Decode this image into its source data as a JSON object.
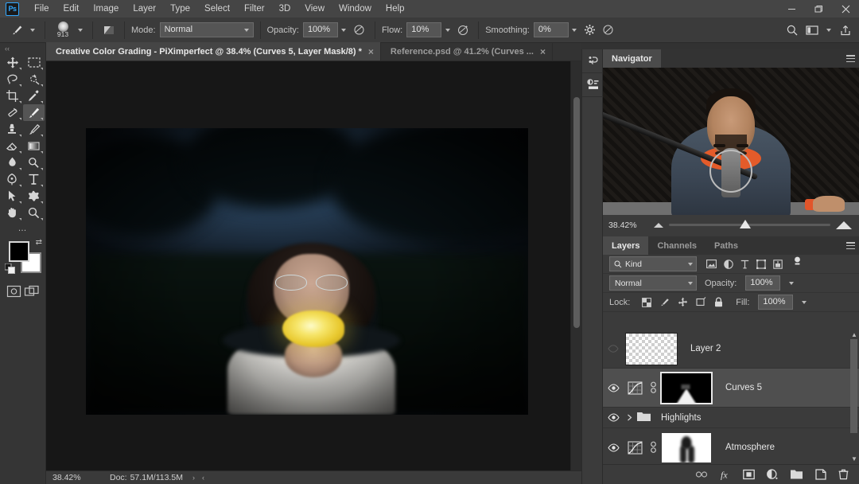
{
  "app": {
    "logo": "Ps",
    "menus": [
      "File",
      "Edit",
      "Image",
      "Layer",
      "Type",
      "Select",
      "Filter",
      "3D",
      "View",
      "Window",
      "Help"
    ],
    "window_controls": {
      "minimize": "minimize-icon",
      "restore": "restore-icon",
      "close": "close-icon"
    }
  },
  "options_bar": {
    "tool_icon": "brush-tool-icon",
    "tool_preset_caret": "chevron-down-icon",
    "brush_size": "913",
    "brush_panel_caret": "chevron-down-icon",
    "brush_settings_icon": "brush-settings-icon",
    "mode_label": "Mode:",
    "mode_value": "Normal",
    "opacity_label": "Opacity:",
    "opacity_value": "100%",
    "pressure_opacity_icon": "pressure-opacity-icon",
    "flow_label": "Flow:",
    "flow_value": "10%",
    "airbrush_icon": "airbrush-icon",
    "smoothing_label": "Smoothing:",
    "smoothing_value": "0%",
    "smoothing_options_icon": "gear-icon",
    "tablet_pressure_icon": "tablet-pressure-icon",
    "right_icons": [
      "search-icon",
      "workspace-icon",
      "chevron-down-icon",
      "share-icon"
    ]
  },
  "toolbar": {
    "collapse_icon": "collapse-chevrons-icon",
    "tools": [
      {
        "name": "move-tool",
        "icon": "move-icon",
        "active": false,
        "has_flyout": true
      },
      {
        "name": "rectangular-marquee-tool",
        "icon": "marquee-icon",
        "active": false,
        "has_flyout": true
      },
      {
        "name": "lasso-tool",
        "icon": "lasso-icon",
        "active": false,
        "has_flyout": true
      },
      {
        "name": "quick-selection-tool",
        "icon": "quick-select-icon",
        "active": false,
        "has_flyout": true
      },
      {
        "name": "crop-tool",
        "icon": "crop-icon",
        "active": false,
        "has_flyout": true
      },
      {
        "name": "eyedropper-tool",
        "icon": "eyedropper-icon",
        "active": false,
        "has_flyout": true
      },
      {
        "name": "spot-healing-brush-tool",
        "icon": "healing-brush-icon",
        "active": false,
        "has_flyout": true
      },
      {
        "name": "brush-tool",
        "icon": "brush-icon",
        "active": true,
        "has_flyout": true
      },
      {
        "name": "clone-stamp-tool",
        "icon": "clone-stamp-icon",
        "active": false,
        "has_flyout": true
      },
      {
        "name": "history-brush-tool",
        "icon": "history-brush-icon",
        "active": false,
        "has_flyout": true
      },
      {
        "name": "eraser-tool",
        "icon": "eraser-icon",
        "active": false,
        "has_flyout": true
      },
      {
        "name": "gradient-tool",
        "icon": "gradient-icon",
        "active": false,
        "has_flyout": true
      },
      {
        "name": "blur-tool",
        "icon": "blur-drop-icon",
        "active": false,
        "has_flyout": true
      },
      {
        "name": "dodge-tool",
        "icon": "dodge-icon",
        "active": false,
        "has_flyout": true
      },
      {
        "name": "pen-tool",
        "icon": "pen-icon",
        "active": false,
        "has_flyout": true
      },
      {
        "name": "type-tool",
        "icon": "type-t-icon",
        "active": false,
        "has_flyout": true
      },
      {
        "name": "path-selection-tool",
        "icon": "path-arrow-icon",
        "active": false,
        "has_flyout": true
      },
      {
        "name": "custom-shape-tool",
        "icon": "shape-icon",
        "active": false,
        "has_flyout": true
      },
      {
        "name": "hand-tool",
        "icon": "hand-icon",
        "active": false,
        "has_flyout": true
      },
      {
        "name": "zoom-tool",
        "icon": "magnifier-icon",
        "active": false,
        "has_flyout": true
      }
    ],
    "more_tools": "…",
    "foreground_color": "#000000",
    "background_color": "#ffffff",
    "swap_icon": "swap-colors-icon",
    "default_icon": "default-colors-icon",
    "quick_mask_icon": "quick-mask-icon",
    "screen_mode_icon": "screen-mode-icon"
  },
  "document_tabs": [
    {
      "title": "Creative Color Grading - PiXimperfect @ 38.4% (Curves 5, Layer Mask/8) *",
      "active": true,
      "close": "×"
    },
    {
      "title": "Reference.psd @ 41.2% (Curves ...",
      "active": false,
      "close": "×"
    }
  ],
  "canvas": {
    "image_alt": "portrait-of-woman-holding-glowing-yellow-rose-at-twilight",
    "scrollbar_v": "canvas-vertical-scrollbar",
    "scrollbar_h": "canvas-horizontal-scrollbar"
  },
  "status_bar": {
    "zoom": "38.42%",
    "doc_label": "Doc:",
    "doc_value": "57.1M/113.5M",
    "next_arrow": "›",
    "prev_arrow": "‹"
  },
  "dock_rail": [
    {
      "name": "history-panel-icon",
      "label": "History"
    },
    {
      "name": "adjustments-panel-icon",
      "label": "Adjustments"
    }
  ],
  "navigator": {
    "tab": "Navigator",
    "menu_icon": "panel-menu-icon",
    "zoom_value": "38.42%",
    "zoom_out_icon": "small-mountain-icon",
    "zoom_in_icon": "large-mountain-icon",
    "slider_position_pct": 44
  },
  "video_overlay": {
    "name": "presenter-webcam-overlay",
    "description": "presenter seated at microphone in acoustic-foam studio"
  },
  "layers_panel": {
    "tabs": [
      {
        "label": "Layers",
        "active": true
      },
      {
        "label": "Channels",
        "active": false
      },
      {
        "label": "Paths",
        "active": false
      }
    ],
    "menu_icon": "panel-menu-icon",
    "filter": {
      "search_icon": "search-icon",
      "kind_value": "Kind",
      "caret": "chevron-down-icon",
      "type_filters": [
        "filter-pixel-layers-icon",
        "filter-adjustment-layers-icon",
        "filter-type-layers-icon",
        "filter-shape-layers-icon",
        "filter-smart-objects-icon"
      ],
      "toggle_icon": "filter-toggle-switch-icon"
    },
    "blend_mode": "Normal",
    "opacity_label": "Opacity:",
    "opacity_value": "100%",
    "lock_label": "Lock:",
    "lock_icons": [
      "lock-transparent-pixels-icon",
      "lock-image-pixels-icon",
      "lock-position-icon",
      "lock-artboard-nesting-icon",
      "lock-all-icon"
    ],
    "fill_label": "Fill:",
    "fill_value": "100%",
    "layers": [
      {
        "name": "Layer 2",
        "type": "pixel",
        "visible": false,
        "selected": false,
        "thumb": "transparent-checkerboard-thumbnail",
        "has_mask": false
      },
      {
        "name": "Curves 5",
        "type": "adjustment",
        "visible": true,
        "selected": true,
        "thumb": "curves-adjustment-icon",
        "has_mask": true,
        "mask": "black-mask-with-white-brush-strokes",
        "link_icon": "link-icon"
      },
      {
        "name": "Highlights",
        "type": "group",
        "visible": true,
        "selected": false,
        "expand_icon": "chevron-right-icon",
        "folder_icon": "folder-icon"
      },
      {
        "name": "Atmosphere",
        "type": "adjustment",
        "visible": true,
        "selected": false,
        "thumb": "curves-adjustment-icon",
        "has_mask": true,
        "mask": "white-mask-with-black-painted-figure",
        "link_icon": "link-icon"
      }
    ],
    "footer_icons": [
      "link-layers-icon",
      "layer-styles-fx-icon",
      "add-layer-mask-icon",
      "new-adjustment-layer-icon",
      "new-group-icon",
      "new-layer-icon",
      "delete-layer-icon"
    ],
    "scrollbar": "layers-scrollbar"
  }
}
